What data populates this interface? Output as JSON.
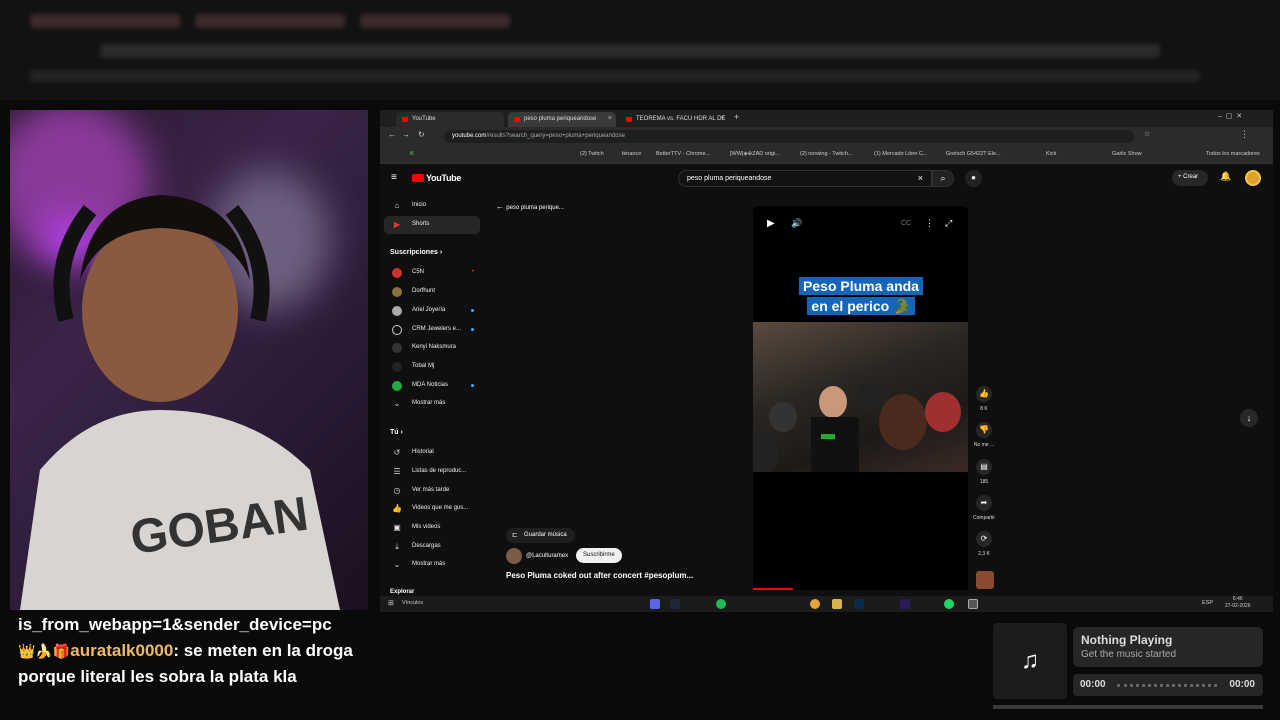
{
  "browser": {
    "tabs": [
      {
        "label": "YouTube"
      },
      {
        "label": "peso pluma periqueandose"
      },
      {
        "label": "TEOREMA vs. FACU HDR AL DE"
      }
    ],
    "url_domain": "youtube.com",
    "url_path": "/results?search_query=peso+pluma+periqueandose",
    "bookmarks": [
      "(2) Twitch",
      "binance",
      "BetterTTV - Chrome...",
      "[WW]◈⊕ZAD origi...",
      "(2) norwing - Twitch...",
      "(1) Mercado Libre C...",
      "Gretsch G5422T Ele...",
      "Kick",
      "Garlic Show",
      "Todos los marcadores"
    ]
  },
  "youtube": {
    "logo": "YouTube",
    "search_value": "peso pluma periqueandose",
    "create_label": "Crear",
    "nav": [
      {
        "label": "Inicio",
        "icon": "home-icon"
      },
      {
        "label": "Shorts",
        "icon": "shorts-icon"
      }
    ],
    "subs_heading": "Suscripciones",
    "subs": [
      {
        "label": "C5N",
        "live": true
      },
      {
        "label": "Dorfhunt"
      },
      {
        "label": "Ariel Joyería",
        "dot": true
      },
      {
        "label": "CRM Jewelers e...",
        "dot": true
      },
      {
        "label": "Kenyi Naksmura"
      },
      {
        "label": "Tobal Mj"
      },
      {
        "label": "MDA Noticias",
        "dot": true
      }
    ],
    "show_more": "Mostrar más",
    "you_heading": "Tú",
    "you_items": [
      {
        "label": "Historial",
        "icon": "history-icon"
      },
      {
        "label": "Listas de reproduc...",
        "icon": "playlist-icon"
      },
      {
        "label": "Ver más tarde",
        "icon": "clock-icon"
      },
      {
        "label": "Videos que me gus...",
        "icon": "like-icon"
      },
      {
        "label": "Mis videos",
        "icon": "video-icon"
      },
      {
        "label": "Descargas",
        "icon": "download-icon"
      }
    ],
    "show_more2": "Mostrar más",
    "explore": "Explorar",
    "back_title": "peso pluma perique...",
    "short": {
      "caption_line1": "Peso Pluma anda",
      "caption_line2": "en el perico 🐊",
      "save_music": "Guardar música",
      "channel": "@Laculturamex",
      "subscribe": "Suscribirme",
      "title": "Peso Pluma coked out after concert #pesoplum...",
      "likes": "8 K",
      "dislike": "No me ...",
      "comments": "185",
      "share": "Compartir",
      "remix": "2,3 K"
    }
  },
  "taskbar": {
    "links": "Vínculos",
    "lang": "ESP",
    "time": "6:46",
    "date": "27-02-2026"
  },
  "chat": {
    "line0": "is_from_webapp=1&sender_device=pc",
    "user": "auratalk0000",
    "message": ": se meten en la droga porque literal les sobra la plata kla"
  },
  "music": {
    "title": "Nothing Playing",
    "subtitle": "Get the music started",
    "time_start": "00:00",
    "time_end": "00:00"
  }
}
